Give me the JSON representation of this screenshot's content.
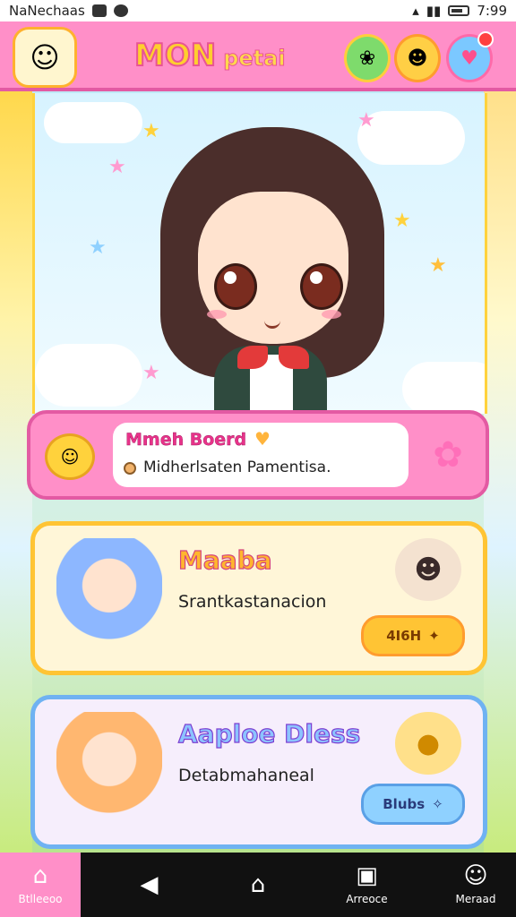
{
  "status_bar": {
    "app_label": "NaNechaas",
    "time": "7:99"
  },
  "header": {
    "title_main": "MON",
    "title_sub": "petai",
    "icons": [
      "avatar-icon",
      "leaf-icon",
      "pet-icon",
      "heart-icon"
    ]
  },
  "message_card": {
    "title": "Mmeh Boerd",
    "text": "Midherlsaten Pamentisa."
  },
  "friends": [
    {
      "name": "Maaba",
      "description": "Srantkastanacion",
      "button_label": "4I6H"
    },
    {
      "name": "Aaploe Dless",
      "description": "Detabmahaneal",
      "button_label": "Blubs"
    }
  ],
  "nav": {
    "items": [
      {
        "label": "Btlleeoo",
        "icon": "home-icon"
      },
      {
        "label": "",
        "icon": "back-icon"
      },
      {
        "label": "",
        "icon": "home-square-icon"
      },
      {
        "label": "Arreoce",
        "icon": "square-icon"
      },
      {
        "label": "Meraad",
        "icon": "profile-icon"
      }
    ]
  },
  "colors": {
    "accent_pink": "#ff8fc8",
    "accent_yellow": "#ffc434",
    "accent_blue": "#6fb2f2"
  }
}
